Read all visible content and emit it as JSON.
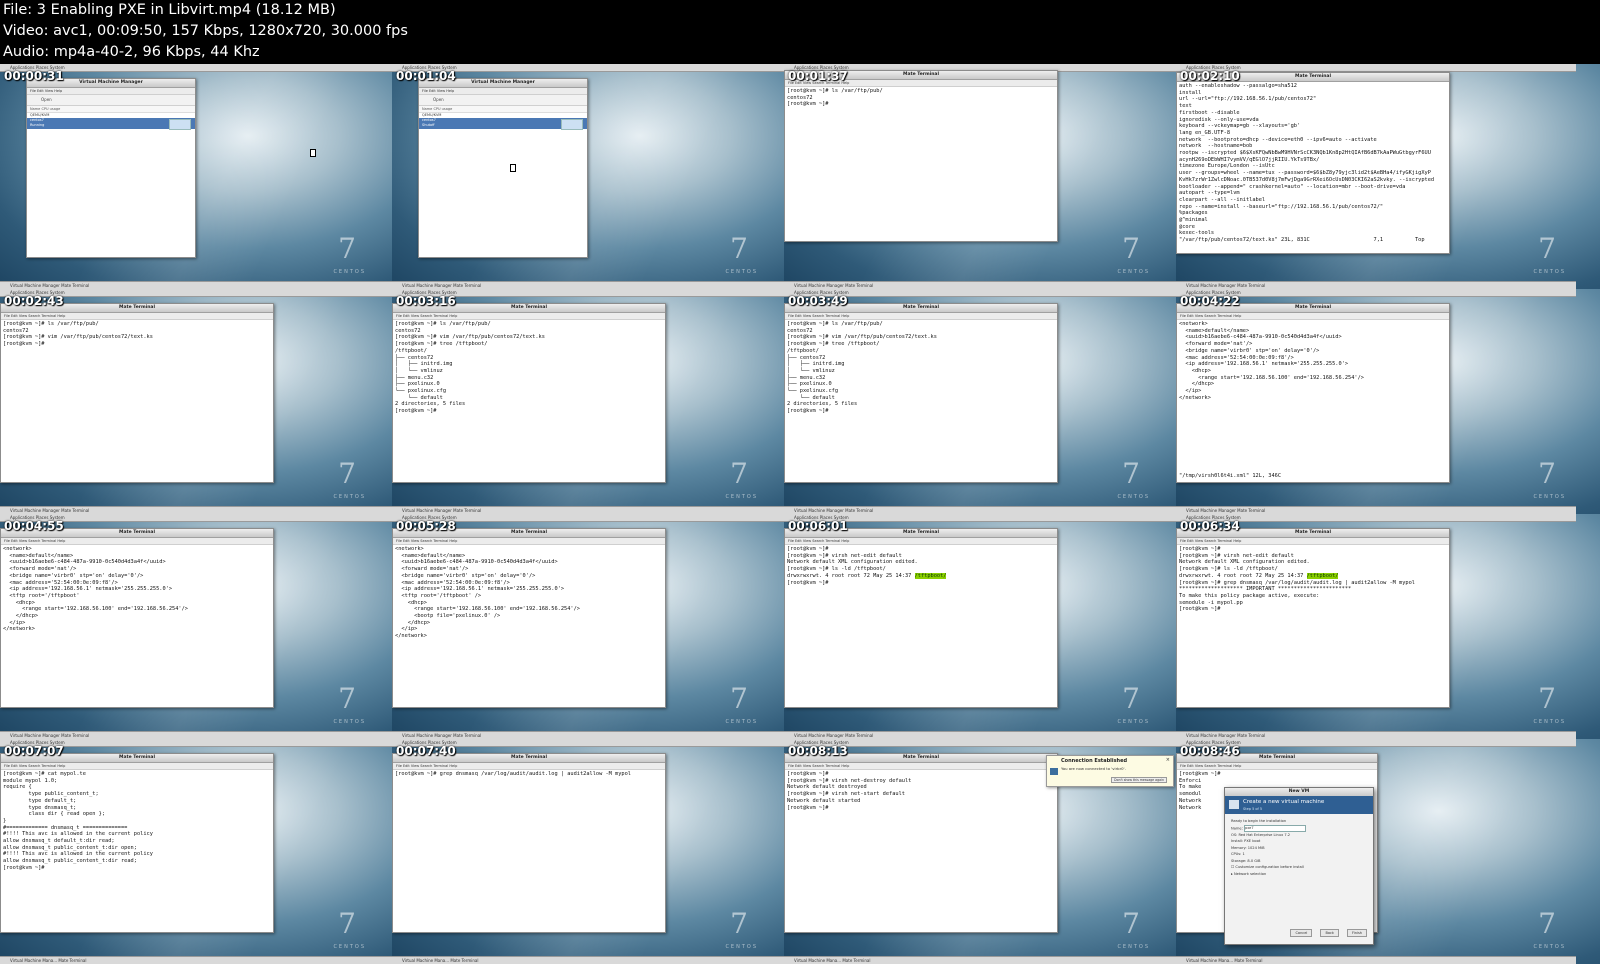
{
  "header": {
    "file_line": "File: 3 Enabling PXE in Libvirt.mp4 (18.12 MB)",
    "video_line": "Video: avc1, 00:09:50, 157 Kbps, 1280x720, 30.000 fps",
    "audio_line": "Audio: mp4a-40-2, 96 Kbps, 44 Khz"
  },
  "desktop": {
    "topbar_text": "Applications  Places  System",
    "taskbar_vmm": "Virtual Machine Manager",
    "taskbar_terminal": "Mate Terminal",
    "taskbar_vmm_short": "Virtual Machine Mana...",
    "watermark_number": "7",
    "watermark_brand": "CENTOS"
  },
  "vmm": {
    "title": "Virtual Machine Manager",
    "menu": "File  Edit  View  Help",
    "toolbar": "Open",
    "columns": "Name                                          CPU usage",
    "host": "QEMU/KVM",
    "vm_name": "centos7",
    "vm_state_running": "Running",
    "vm_state_shutoff": "Shutoff"
  },
  "terminal": {
    "title": "Mate Terminal",
    "menu": "File  Edit  View  Search  Terminal  Help"
  },
  "thumbs": [
    {
      "time": "00:00:31"
    },
    {
      "time": "00:01:04"
    },
    {
      "time": "00:01:37",
      "lines": [
        "[root@kvm ~]# ls /var/ftp/pub/",
        "centos72",
        "[root@kvm ~]#"
      ]
    },
    {
      "time": "00:02:10",
      "lines": [
        "auth --enableshadow --passalgo=sha512",
        "install",
        "url --url=\"ftp://192.168.56.1/pub/centos72\"",
        "text",
        "firstboot --disable",
        "ignoredisk --only-use=vda",
        "keyboard --vckeymap=gb --xlayouts='gb'",
        "lang en_GB.UTF-8",
        "network  --bootproto=dhcp --device=eth0 --ipv6=auto --activate",
        "network  --hostname=bob",
        "rootpw --iscrypted $6$XsKFQwNbBwM9HVNrScCK3NQb1Kn8p2HtQIAfB6dB7kAaPWuGtbgyrF6UU",
        "acynH269oDEbWHI7vymVV/qEGlO7jjRIIU.YkTs9TBx/",
        "timezone Europe/London --isUtc",
        "user --groups=wheel --name=tux --password=$6$bZ8y79yjc3lid2t$AeBHa4/ifyGKjigXyP",
        "KvHk7zrWr1ZwlcDNoac.0TB537d0V8j7mFwjDga9GrRXei6OcUsDN03CKI62aS2kvky. --iscrypted",
        "bootloader --append=\" crashkernel=auto\" --location=mbr --boot-drive=vda",
        "autopart --type=lvm",
        "clearpart --all --initlabel",
        "repo --name=install --baseurl=\"ftp://192.168.56.1/pub/centos72/\"",
        "%packages",
        "@^minimal",
        "@core",
        "kexec-tools",
        "\"/var/ftp/pub/centos72/text.ks\" 23L, 831C                    7,1          Top"
      ]
    },
    {
      "time": "00:02:43",
      "lines": [
        "[root@kvm ~]# ls /var/ftp/pub/",
        "centos72",
        "[root@kvm ~]# vim /var/ftp/pub/centos72/text.ks",
        "[root@kvm ~]#"
      ]
    },
    {
      "time": "00:03:16",
      "lines": [
        "[root@kvm ~]# ls /var/ftp/pub/",
        "centos72",
        "[root@kvm ~]# vim /var/ftp/pub/centos72/text.ks",
        "[root@kvm ~]# tree /tftpboot/",
        "/tftpboot/",
        "├── centos72",
        "│   ├── initrd.img",
        "│   └── vmlinuz",
        "├── menu.c32",
        "├── pxelinux.0",
        "└── pxelinux.cfg",
        "    └── default",
        "",
        "2 directories, 5 files",
        "[root@kvm ~]#"
      ]
    },
    {
      "time": "00:03:49",
      "lines": [
        "[root@kvm ~]# ls /var/ftp/pub/",
        "centos72",
        "[root@kvm ~]# vim /var/ftp/pub/centos72/text.ks",
        "[root@kvm ~]# tree /tftpboot/",
        "/tftpboot/",
        "├── centos72",
        "│   ├── initrd.img",
        "│   └── vmlinuz",
        "├── menu.c32",
        "├── pxelinux.0",
        "└── pxelinux.cfg",
        "    └── default",
        "",
        "2 directories, 5 files",
        "[root@kvm ~]#"
      ]
    },
    {
      "time": "00:04:22",
      "lines": [
        "<network>",
        "  <name>default</name>",
        "  <uuid>b16aebe6-c484-487a-9910-0c540d4d3a4f</uuid>",
        "  <forward mode='nat'/>",
        "  <bridge name='virbr0' stp='on' delay='0'/>",
        "  <mac address='52:54:00:0e:09:f8'/>",
        "  <ip address='192.168.56.1' netmask='255.255.255.0'>",
        "    <dhcp>",
        "      <range start='192.168.56.100' end='192.168.56.254'/>",
        "    </dhcp>",
        "  </ip>",
        "</network>"
      ],
      "status": "\"/tmp/virsh0l6t4i.xml\" 12L, 346C"
    },
    {
      "time": "00:04:55",
      "lines": [
        "<network>",
        "  <name>default</name>",
        "  <uuid>b16aebe6-c484-487a-9910-0c540d4d3a4f</uuid>",
        "  <forward mode='nat'/>",
        "  <bridge name='virbr0' stp='on' delay='0'/>",
        "  <mac address='52:54:00:0e:09:f8'/>",
        "  <ip address='192.168.56.1' netmask='255.255.255.0'>",
        "  <tftp root='/tftpboot'",
        "    <dhcp>",
        "      <range start='192.168.56.100' end='192.168.56.254'/>",
        "    </dhcp>",
        "  </ip>",
        "</network>"
      ]
    },
    {
      "time": "00:05:28",
      "lines": [
        "<network>",
        "  <name>default</name>",
        "  <uuid>b16aebe6-c484-487a-9910-0c540d4d3a4f</uuid>",
        "  <forward mode='nat'/>",
        "  <bridge name='virbr0' stp='on' delay='0'/>",
        "  <mac address='52:54:00:0e:09:f8'/>",
        "  <ip address='192.168.56.1' netmask='255.255.255.0'>",
        "  <tftp root='/tftpboot' />",
        "    <dhcp>",
        "      <range start='192.168.56.100' end='192.168.56.254'/>",
        "      <bootp file='pxelinux.0' />",
        "    </dhcp>",
        "  </ip>",
        "</network>"
      ]
    },
    {
      "time": "00:06:01",
      "lines": [
        "[root@kvm ~]#",
        "[root@kvm ~]# virsh net-edit default",
        "Network default XML configuration edited.",
        "",
        "[root@kvm ~]# ls -ld /tftpboot/"
      ],
      "ls_prefix": "drwxrwxrwt. 4 root root 72 May 25 14:37 ",
      "ls_highlight": "/tftpboot/",
      "tail": "[root@kvm ~]#"
    },
    {
      "time": "00:06:34",
      "lines": [
        "[root@kvm ~]#",
        "[root@kvm ~]# virsh net-edit default",
        "Network default XML configuration edited.",
        "",
        "[root@kvm ~]# ls -ld /tftpboot/"
      ],
      "ls_prefix": "drwxrwxrwt. 4 root root 72 May 25 14:37 ",
      "ls_highlight": "/tftpboot/",
      "tail_lines": [
        "[root@kvm ~]# grep dnsmasq /var/log/audit/audit.log | audit2allow -M mypol",
        "******************** IMPORTANT ***********************",
        "To make this policy package active, execute:",
        "",
        "semodule -i mypol.pp",
        "",
        "[root@kvm ~]#"
      ]
    },
    {
      "time": "00:07:07",
      "lines": [
        "[root@kvm ~]# cat mypol.te",
        "",
        "module mypol 1.0;",
        "",
        "require {",
        "        type public_content_t;",
        "        type default_t;",
        "        type dnsmasq_t;",
        "        class dir { read open };",
        "}",
        "",
        "#============= dnsmasq_t ==============",
        "",
        "#!!!! This avc is allowed in the current policy",
        "allow dnsmasq_t default_t:dir read;",
        "allow dnsmasq_t public_content_t:dir open;",
        "",
        "#!!!! This avc is allowed in the current policy",
        "allow dnsmasq_t public_content_t:dir read;",
        "[root@kvm ~]#"
      ]
    },
    {
      "time": "00:07:40",
      "lines": [
        "[root@kvm ~]# grep dnsmasq /var/log/audit/audit.log | audit2allow -M mypol"
      ]
    },
    {
      "time": "00:08:13",
      "lines": [
        "[root@kvm ~]#",
        "[root@kvm ~]# virsh net-destroy default",
        "Network default destroyed",
        "",
        "[root@kvm ~]# virsh net-start default",
        "Network default started",
        "",
        "[root@kvm ~]#"
      ],
      "notif_title": "Connection Established",
      "notif_text": "You are now connected to 'virbr0'.",
      "notif_btn": "Don't show this message again"
    },
    {
      "time": "00:08:46",
      "lines": [
        "[root@kvm ~]#",
        "Enforci",
        "To make",
        "",
        "semodul",
        "",
        "Network",
        "",
        "Network"
      ],
      "dialog_title": "New VM",
      "dialog_banner": "Create a new virtual machine",
      "dialog_step": "Step 5 of 5",
      "dlg_ready": "Ready to begin the installation",
      "dlg_name_label": "Name:",
      "dlg_name_value": "pxe7",
      "dlg_os": "OS: Red Hat Enterprise Linux 7.2",
      "dlg_install": "Install: PXE boot",
      "dlg_memory": "Memory: 1024 MiB",
      "dlg_cpus": "CPUs: 1",
      "dlg_storage": "Storage: 8.0 GiB",
      "dlg_customize": "Customize configuration before install",
      "dlg_network": "Network selection",
      "btn_cancel": "Cancel",
      "btn_back": "Back",
      "btn_finish": "Finish"
    }
  ]
}
